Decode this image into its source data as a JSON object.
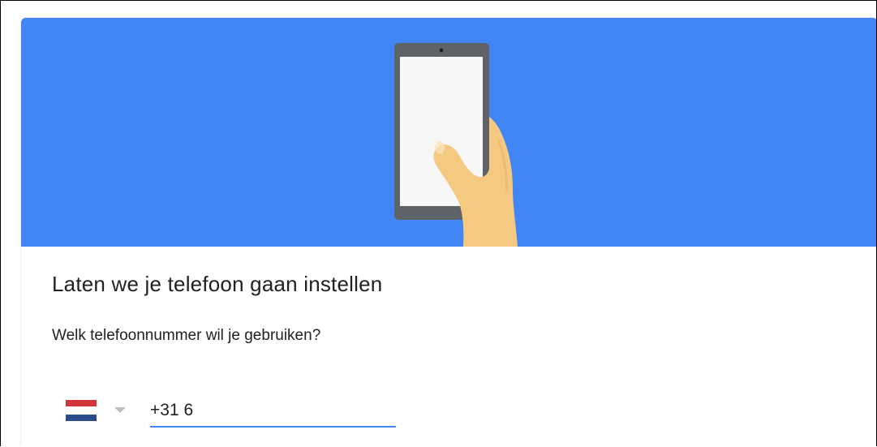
{
  "banner": {
    "illustration": "hand-holding-phone",
    "background_color": "#4285f4"
  },
  "setup": {
    "heading": "Laten we je telefoon gaan instellen",
    "question": "Welk telefoonnummer wil je gebruiken?"
  },
  "phone_input": {
    "country": "Netherlands",
    "flag_icon": "netherlands-flag-icon",
    "value": "+31 6",
    "underline_color": "#4285f4"
  }
}
